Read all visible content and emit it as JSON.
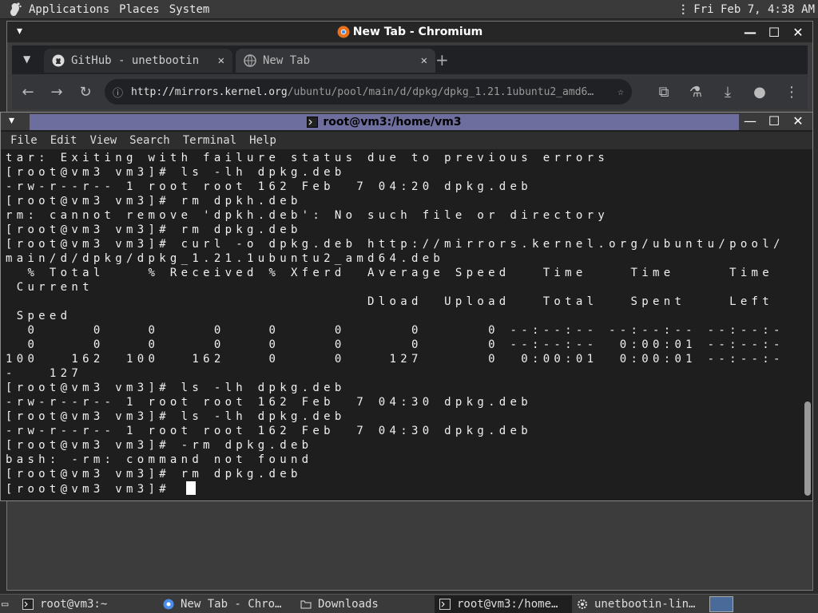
{
  "top_panel": {
    "menus": [
      "Applications",
      "Places",
      "System"
    ],
    "clock": "Fri Feb  7,  4:38 AM"
  },
  "browser": {
    "title": "New Tab - Chromium",
    "tabs": [
      {
        "label": "GitHub - unetbootin",
        "close": "✕"
      },
      {
        "label": "New Tab",
        "close": "✕"
      }
    ],
    "new_tab": "+",
    "url_host": "http://mirrors.kernel.org",
    "url_path": "/ubuntu/pool/main/d/dpkg/dpkg_1.21.1ubuntu2_amd6…"
  },
  "terminal": {
    "title": "root@vm3:/home/vm3",
    "menus": [
      "File",
      "Edit",
      "View",
      "Search",
      "Terminal",
      "Help"
    ],
    "lines": [
      "tar: Exiting with failure status due to previous errors",
      "[root@vm3 vm3]# ls -lh dpkg.deb",
      "-rw-r--r-- 1 root root 162 Feb  7 04:20 dpkg.deb",
      "[root@vm3 vm3]# rm dpkh.deb",
      "rm: cannot remove 'dpkh.deb': No such file or directory",
      "[root@vm3 vm3]# rm dpkg.deb",
      "[root@vm3 vm3]# curl -o dpkg.deb http://mirrors.kernel.org/ubuntu/pool/",
      "main/d/dpkg/dpkg_1.21.1ubuntu2_amd64.deb",
      "  % Total    % Received % Xferd  Average Speed   Time    Time     Time",
      " Current",
      "                                 Dload  Upload   Total   Spent    Left",
      " Speed",
      "  0     0    0     0    0     0      0      0 --:--:-- --:--:-- --:--:-",
      "  0     0    0     0    0     0      0      0 --:--:--  0:00:01 --:--:-",
      "100   162  100   162    0     0    127      0  0:00:01  0:00:01 --:--:-",
      "-   127",
      "[root@vm3 vm3]# ls -lh dpkg.deb",
      "-rw-r--r-- 1 root root 162 Feb  7 04:30 dpkg.deb",
      "[root@vm3 vm3]# ls -lh dpkg.deb",
      "-rw-r--r-- 1 root root 162 Feb  7 04:30 dpkg.deb",
      "[root@vm3 vm3]# -rm dpkg.deb",
      "bash: -rm: command not found",
      "[root@vm3 vm3]# rm dpkg.deb",
      "[root@vm3 vm3]# "
    ]
  },
  "taskbar": {
    "items": [
      {
        "label": "root@vm3:~"
      },
      {
        "label": "New Tab - Chro…"
      },
      {
        "label": "Downloads"
      },
      {
        "label": "root@vm3:/home…"
      },
      {
        "label": "unetbootin-lin…"
      }
    ]
  }
}
